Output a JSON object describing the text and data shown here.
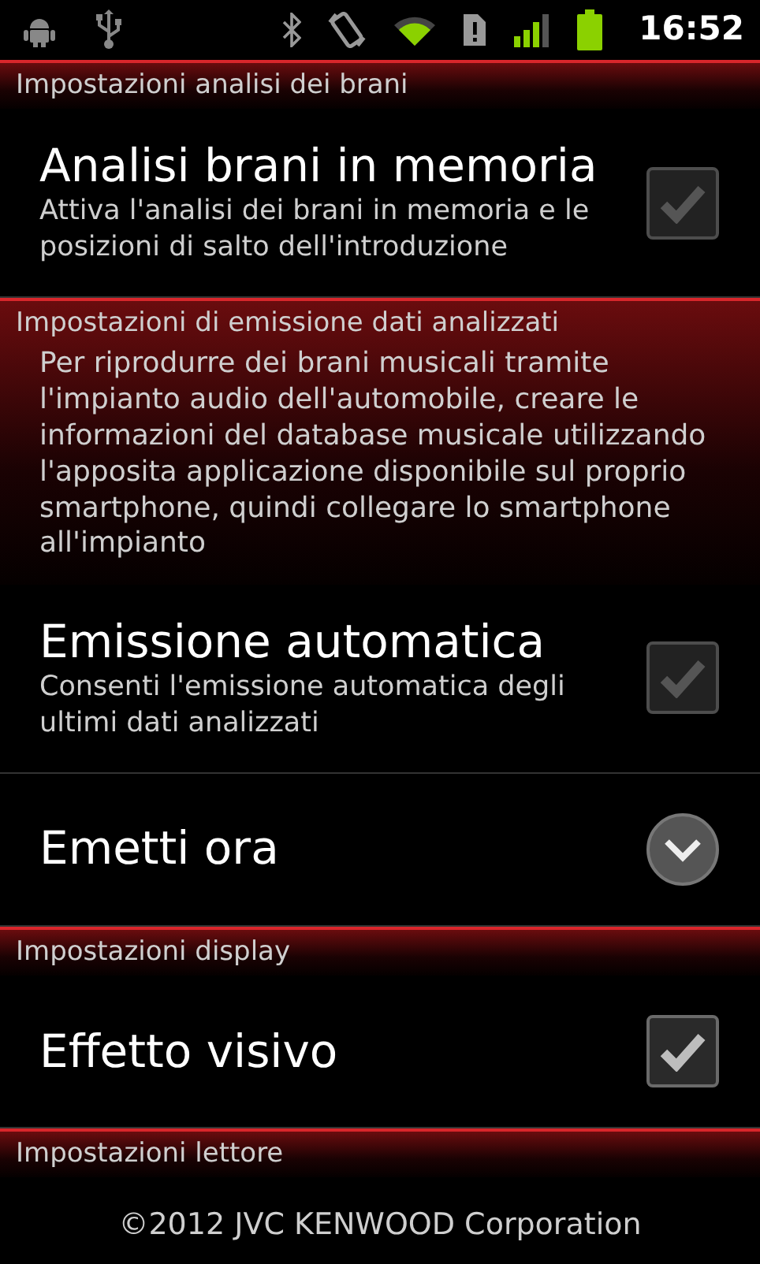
{
  "status_bar": {
    "time": "16:52"
  },
  "sections": [
    {
      "title": "Impostazioni analisi dei brani",
      "items": [
        {
          "kind": "checkbox",
          "title": "Analisi brani in memoria",
          "summary": "Attiva l'analisi dei brani in memoria e le posizioni di salto dell'introduzione",
          "checked": true,
          "disabled": true
        }
      ]
    },
    {
      "title": "Impostazioni di emissione dati analizzati",
      "description": "Per riprodurre dei brani musicali tramite l'impianto audio dell'automobile, creare le informazioni del database musicale utilizzando l'apposita applicazione disponibile sul proprio smartphone, quindi collegare lo smartphone all'impianto",
      "items": [
        {
          "kind": "checkbox",
          "title": "Emissione automatica",
          "summary": "Consenti l'emissione automatica degli ultimi dati analizzati",
          "checked": true,
          "disabled": true
        },
        {
          "kind": "expand",
          "title": "Emetti ora"
        }
      ]
    },
    {
      "title": "Impostazioni display",
      "items": [
        {
          "kind": "checkbox",
          "title": "Effetto visivo",
          "checked": true,
          "disabled": false
        }
      ]
    },
    {
      "title": "Impostazioni lettore"
    }
  ],
  "footer": "©2012 JVC KENWOOD Corporation"
}
